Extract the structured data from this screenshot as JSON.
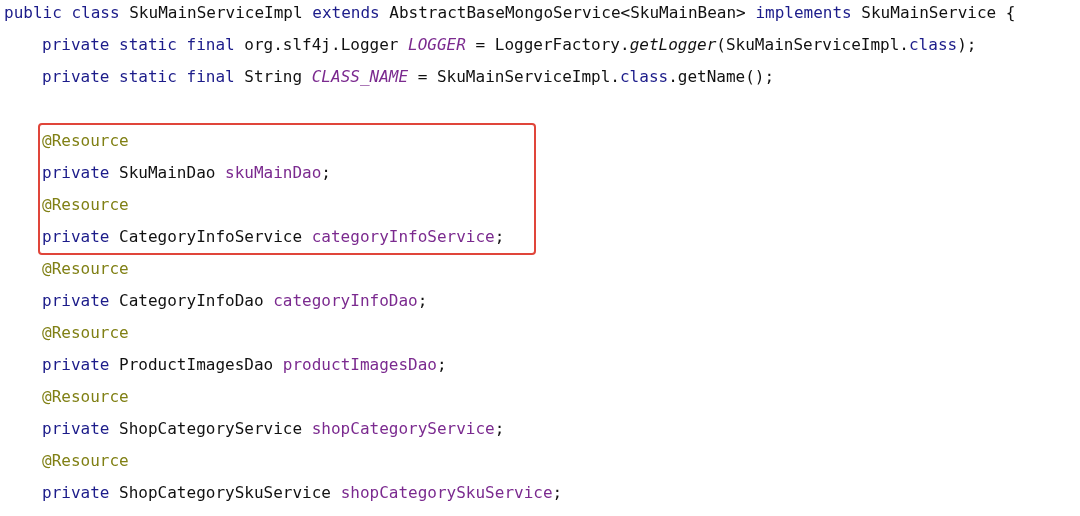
{
  "code": {
    "lines": [
      {
        "kind": "code",
        "tokens": [
          {
            "kind": "keyword",
            "text": "public class "
          },
          {
            "kind": "plain",
            "text": "SkuMainServiceImpl "
          },
          {
            "kind": "keyword",
            "text": "extends "
          },
          {
            "kind": "plain",
            "text": "AbstractBaseMongoService<SkuMainBean> "
          },
          {
            "kind": "keyword",
            "text": "implements "
          },
          {
            "kind": "plain",
            "text": "SkuMainService {"
          }
        ],
        "children": [
          {
            "kind": "code",
            "highlighted": false,
            "tokens": [
              {
                "kind": "keyword",
                "text": "private static final "
              },
              {
                "kind": "plain",
                "text": "org.slf4j.Logger "
              },
              {
                "kind": "static_field",
                "text": "LOGGER"
              },
              {
                "kind": "plain",
                "text": " = LoggerFactory."
              },
              {
                "kind": "static_method",
                "text": "getLogger"
              },
              {
                "kind": "plain",
                "text": "(SkuMainServiceImpl."
              },
              {
                "kind": "keyword",
                "text": "class"
              },
              {
                "kind": "plain",
                "text": ");"
              }
            ]
          },
          {
            "kind": "code",
            "highlighted": false,
            "tokens": [
              {
                "kind": "keyword",
                "text": "private static final "
              },
              {
                "kind": "plain",
                "text": "String "
              },
              {
                "kind": "static_field",
                "text": "CLASS_NAME"
              },
              {
                "kind": "plain",
                "text": " = SkuMainServiceImpl."
              },
              {
                "kind": "keyword",
                "text": "class"
              },
              {
                "kind": "plain",
                "text": ".getName();"
              }
            ]
          },
          {
            "kind": "blank"
          },
          {
            "kind": "code",
            "highlighted": true,
            "tokens": [
              {
                "kind": "annotation",
                "text": "@Resource"
              }
            ]
          },
          {
            "kind": "code",
            "highlighted": true,
            "tokens": [
              {
                "kind": "keyword",
                "text": "private "
              },
              {
                "kind": "plain",
                "text": "SkuMainDao "
              },
              {
                "kind": "field",
                "text": "skuMainDao"
              },
              {
                "kind": "plain",
                "text": ";"
              }
            ]
          },
          {
            "kind": "code",
            "highlighted": true,
            "tokens": [
              {
                "kind": "annotation",
                "text": "@Resource"
              }
            ]
          },
          {
            "kind": "code",
            "highlighted": true,
            "tokens": [
              {
                "kind": "keyword",
                "text": "private "
              },
              {
                "kind": "plain",
                "text": "CategoryInfoService "
              },
              {
                "kind": "field",
                "text": "categoryInfoService"
              },
              {
                "kind": "plain",
                "text": ";"
              }
            ]
          },
          {
            "kind": "code",
            "highlighted": false,
            "tokens": [
              {
                "kind": "annotation",
                "text": "@Resource"
              }
            ]
          },
          {
            "kind": "code",
            "highlighted": false,
            "tokens": [
              {
                "kind": "keyword",
                "text": "private "
              },
              {
                "kind": "plain",
                "text": "CategoryInfoDao "
              },
              {
                "kind": "field",
                "text": "categoryInfoDao"
              },
              {
                "kind": "plain",
                "text": ";"
              }
            ]
          },
          {
            "kind": "code",
            "highlighted": false,
            "tokens": [
              {
                "kind": "annotation",
                "text": "@Resource"
              }
            ]
          },
          {
            "kind": "code",
            "highlighted": false,
            "tokens": [
              {
                "kind": "keyword",
                "text": "private "
              },
              {
                "kind": "plain",
                "text": "ProductImagesDao "
              },
              {
                "kind": "field",
                "text": "productImagesDao"
              },
              {
                "kind": "plain",
                "text": ";"
              }
            ]
          },
          {
            "kind": "code",
            "highlighted": false,
            "tokens": [
              {
                "kind": "annotation",
                "text": "@Resource"
              }
            ]
          },
          {
            "kind": "code",
            "highlighted": false,
            "tokens": [
              {
                "kind": "keyword",
                "text": "private "
              },
              {
                "kind": "plain",
                "text": "ShopCategoryService "
              },
              {
                "kind": "field",
                "text": "shopCategoryService"
              },
              {
                "kind": "plain",
                "text": ";"
              }
            ]
          },
          {
            "kind": "code",
            "highlighted": false,
            "tokens": [
              {
                "kind": "annotation",
                "text": "@Resource"
              }
            ]
          },
          {
            "kind": "code",
            "highlighted": false,
            "tokens": [
              {
                "kind": "keyword",
                "text": "private "
              },
              {
                "kind": "plain",
                "text": "ShopCategorySkuService "
              },
              {
                "kind": "field",
                "text": "shopCategorySkuService"
              },
              {
                "kind": "plain",
                "text": ";"
              }
            ]
          }
        ]
      }
    ]
  }
}
